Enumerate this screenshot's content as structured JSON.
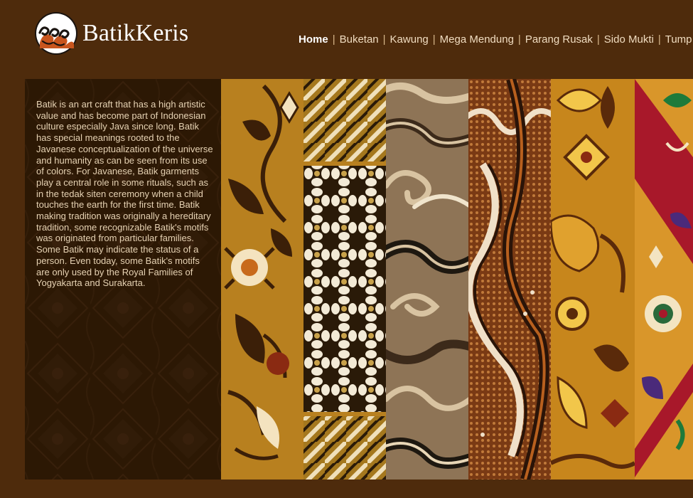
{
  "brand": {
    "name": "BatikKeris"
  },
  "nav": {
    "items": [
      {
        "label": "Home",
        "active": true
      },
      {
        "label": "Buketan"
      },
      {
        "label": "Kawung"
      },
      {
        "label": "Mega Mendung"
      },
      {
        "label": "Parang Rusak"
      },
      {
        "label": "Sido Mukti"
      },
      {
        "label": "Tump"
      }
    ],
    "separator": "|"
  },
  "intro": {
    "text": "Batik is an art craft that has a high artistic value and has become part of Indonesian culture especially Java since long. Batik has special meanings rooted to the Javanese conceptualization of the universe and humanity as can be seen from its use of colors. For Javanese, Batik garments play a central role in some rituals, such as in the tedak siten ceremony when a child touches the earth for the first time. Batik making tradition was originally a hereditary tradition, some recognizable Batik's motifs was originated from particular families. Some Batik may indicate the status of a person. Even today, some Batik's motifs are only used by the Royal Families of Yogyakarta and Surakarta."
  },
  "colors": {
    "page_bg": "#4e2b0c",
    "panel_bg": "#2d1906",
    "nav_text": "#f0dcc0",
    "logo_orange": "#c8551e"
  },
  "strips": [
    {
      "motif": "buketan-floral"
    },
    {
      "motif": "kawung"
    },
    {
      "motif": "mega-mendung"
    },
    {
      "motif": "parang-rusak"
    },
    {
      "motif": "sido-mukti"
    },
    {
      "motif": "tumpal"
    }
  ]
}
